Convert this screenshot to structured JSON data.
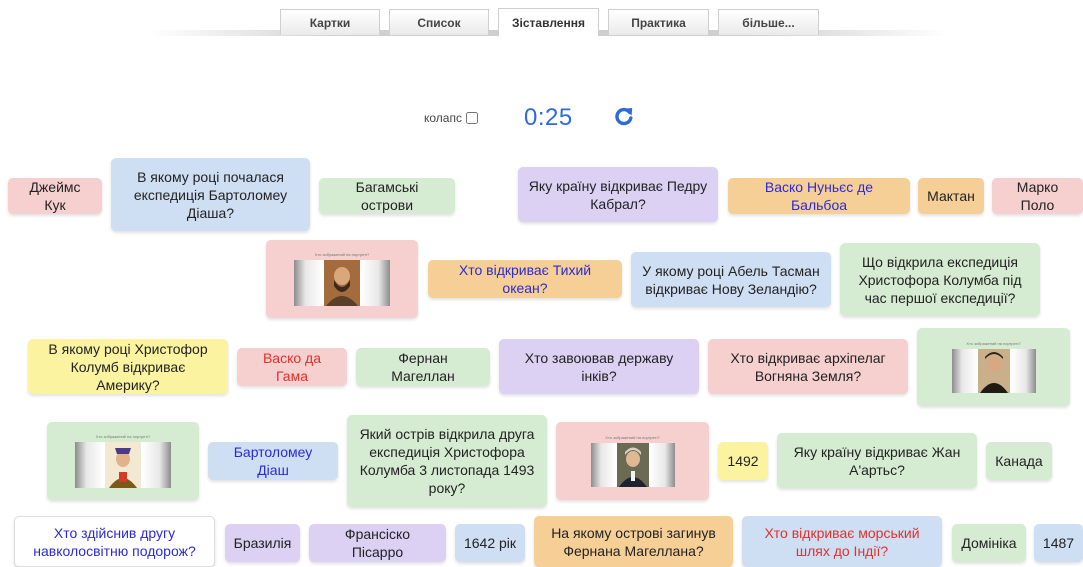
{
  "tabs": [
    {
      "label": "Картки",
      "active": false
    },
    {
      "label": "Список",
      "active": false
    },
    {
      "label": "Зіставлення",
      "active": true
    },
    {
      "label": "Практика",
      "active": false
    },
    {
      "label": "більше...",
      "active": false
    }
  ],
  "controls": {
    "collapse_label": "колапс",
    "collapse_checked": false,
    "timer": "0:25",
    "refresh_icon": "refresh-icon"
  },
  "cards": {
    "c1": "Джеймс Кук",
    "c2": "В якому році почалася експедиція Бартоломеу Діаша?",
    "c3": "Багамські острови",
    "c4": "Яку країну відкриває Педру Кабрал?",
    "c5": "Васко Нуньєс де Бальбоа",
    "c6": "Мактан",
    "c7": "Марко Поло",
    "c8_caption": "Хто зображений на портреті?",
    "c9": "Хто відкриває Тихий океан?",
    "c10": "У якому році Абель Тасман відкриває Нову Зеландію?",
    "c11": "Що відкрила експедиція Христофора Колумба під час першої експедиції?",
    "c12": "В якому році Христофор Колумб відкриває Америку?",
    "c13": "Васко да Гама",
    "c14": "Фернан Магеллан",
    "c15": "Хто завоював державу інків?",
    "c16": "Хто відкриває архіпелаг Вогняна Земля?",
    "c17_caption": "Хто зображений на портреті?",
    "c18_caption": "Хто зображений на портреті?",
    "c19": "Бартоломеу Діаш",
    "c20": "Який острів відкрила друга експедиція Христофора Колумба 3 листопада 1493 року?",
    "c21_caption": "Хто зображений на портреті?",
    "c22": "1492",
    "c23": "Яку країну відкриває Жан А'артьс?",
    "c24": "Канада",
    "c25": "Хто здійснив другу навколосвітню подорож?",
    "c26": "Бразилія",
    "c27": "Франсіско Пісарро",
    "c28": "1642 рік",
    "c29": "На якому острові загинув Фернана Магеллана?",
    "c30": "Хто відкриває морський шлях до Індії?",
    "c31": "Домініка",
    "c32": "1487"
  }
}
